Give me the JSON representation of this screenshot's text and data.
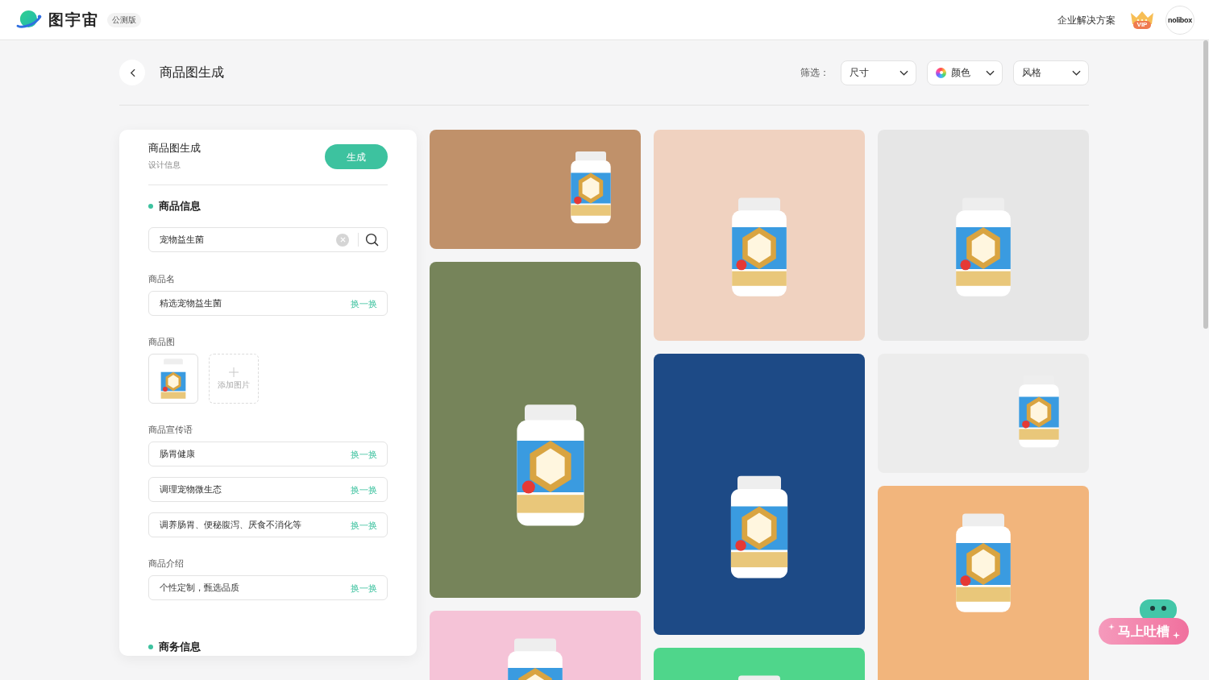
{
  "header": {
    "logo_text": "图宇宙",
    "badge": "公测版",
    "link": "企业解决方案",
    "vip": "VIP",
    "avatar": "nolibox"
  },
  "page": {
    "title": "商品图生成",
    "filter_label": "筛选：",
    "filters": [
      {
        "label": "尺寸",
        "kind": "plain"
      },
      {
        "label": "颜色",
        "kind": "color"
      },
      {
        "label": "风格",
        "kind": "plain"
      }
    ]
  },
  "form": {
    "title": "商品图生成",
    "subtitle": "设计信息",
    "generate": "生成",
    "sections": [
      {
        "title": "商品信息",
        "search": {
          "value": "宠物益生菌"
        },
        "fields": [
          {
            "kind": "text",
            "label": "商品名",
            "inputs": [
              {
                "value": "精选宠物益生菌",
                "action": "换一换"
              }
            ]
          },
          {
            "kind": "images",
            "label": "商品图",
            "images": [
              {
                "kind": "bottle"
              }
            ],
            "add_label": "添加图片"
          },
          {
            "kind": "text",
            "label": "商品宣传语",
            "inputs": [
              {
                "value": "肠胃健康",
                "action": "换一换"
              },
              {
                "value": "调理宠物微生态",
                "action": "换一换"
              },
              {
                "value": "调养肠胃、便秘腹泻、厌食不消化等",
                "action": "换一换"
              }
            ]
          },
          {
            "kind": "text",
            "label": "商品介绍",
            "inputs": [
              {
                "value": "个性定制，甄选品质",
                "action": "换一换"
              }
            ]
          }
        ]
      },
      {
        "title": "商务信息"
      }
    ]
  },
  "gallery": {
    "columns": [
      [
        {
          "kind": "short",
          "color": "#c0916a"
        },
        {
          "kind": "xlarge",
          "color": "#76845a"
        },
        {
          "kind": "cut",
          "color": "#f5c3d7"
        }
      ],
      [
        {
          "kind": "medium",
          "color": "#f0d2c0"
        },
        {
          "kind": "large",
          "color": "#1d4a86"
        },
        {
          "kind": "cut",
          "color": "#4fd68b"
        }
      ],
      [
        {
          "kind": "medium",
          "color": "#e6e6e6"
        },
        {
          "kind": "short",
          "color": "#ececec"
        },
        {
          "kind": "cut",
          "color": "#f2b57c"
        }
      ]
    ]
  },
  "feedback_button": "马上吐槽"
}
